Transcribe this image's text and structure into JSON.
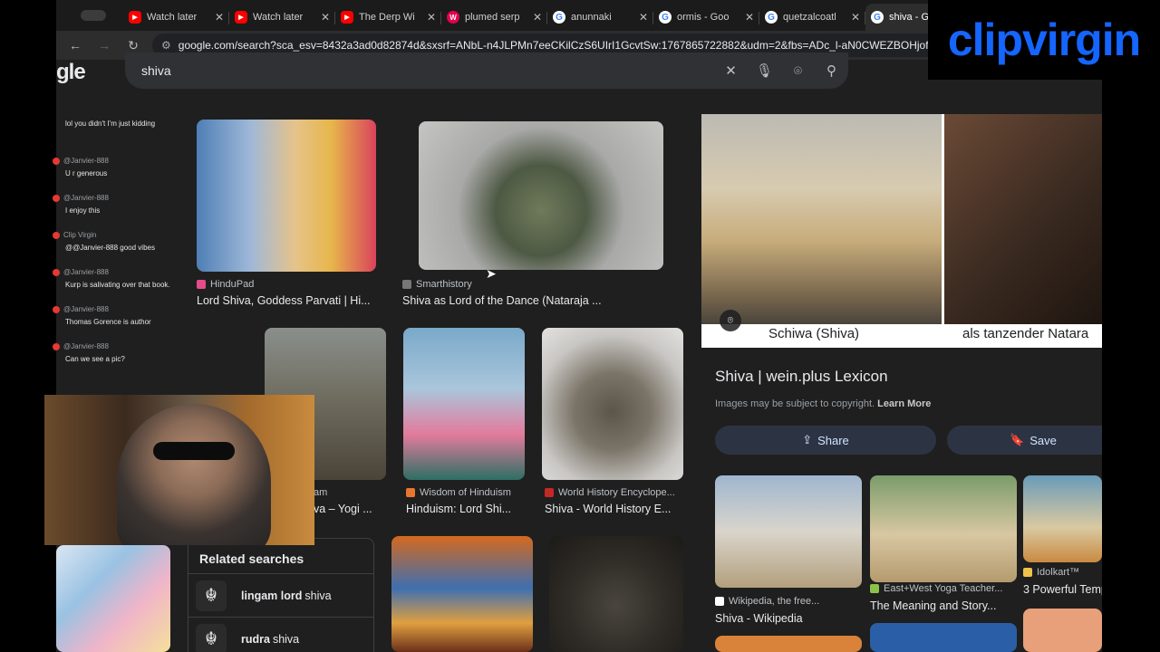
{
  "tabs": [
    {
      "title": "Watch later",
      "icon": "youtube-icon",
      "kind": "yt"
    },
    {
      "title": "Watch later",
      "icon": "youtube-icon",
      "kind": "yt"
    },
    {
      "title": "The Derp Wi",
      "icon": "youtube-icon",
      "kind": "yt"
    },
    {
      "title": "plumed serp",
      "icon": "wiki-icon",
      "kind": "wiki"
    },
    {
      "title": "anunnaki",
      "icon": "google-icon",
      "kind": "goog"
    },
    {
      "title": "ormis - Goo",
      "icon": "google-icon",
      "kind": "goog"
    },
    {
      "title": "quetzalcoatl",
      "icon": "google-icon",
      "kind": "goog"
    },
    {
      "title": "shiva - G",
      "icon": "google-icon",
      "kind": "goog",
      "active": true
    }
  ],
  "toolbar": {
    "url": "google.com/search?sca_esv=8432a3ad0d82874d&sxsrf=ANbL-n4JLPMn7eeCKilCzS6UIrI1GcvtSw:1767865722882&udm=2&fbs=ADc_l-aN0CWEZBOHjofHo"
  },
  "search": {
    "logo_fragment": "gle",
    "query": "shiva"
  },
  "results": [
    {
      "source": "HinduPad",
      "title": "Lord Shiva, Goddess Parvati | Hi...",
      "color": "#e54b8a"
    },
    {
      "source": "Smarthistory",
      "title": "Shiva as Lord of the Dance (Nataraja ...",
      "color": "#777777"
    },
    {
      "source": "Wisdom of Hinduism",
      "title": "Hinduism: Lord Shi...",
      "color": "#e8772e"
    },
    {
      "source": "World History Encyclope...",
      "title": "Shiva - World History E...",
      "color": "#c62828"
    },
    {
      "source": "am",
      "title": "va – Yogi ...",
      "color": "#8a6d3b"
    }
  ],
  "panel": {
    "captions": [
      "Schiwa (Shiva)",
      "als tanzender Natara"
    ],
    "title": "Shiva | wein.plus Lexicon",
    "copyright": "Images may be subject to copyright.",
    "learn_more": "Learn More",
    "share": "Share",
    "save": "Save",
    "related": [
      {
        "source": "Wikipedia, the free...",
        "title": "Shiva - Wikipedia"
      },
      {
        "source": "East+West Yoga Teacher...",
        "title": "The Meaning and Story..."
      },
      {
        "source": "Idolkart™",
        "title": "3 Powerful Temp"
      }
    ]
  },
  "related_searches": {
    "heading": "Related searches",
    "items": [
      {
        "bold": "lingam lord",
        "rest": "shiva"
      },
      {
        "bold": "rudra",
        "rest": "shiva"
      }
    ]
  },
  "chat": [
    {
      "name": "",
      "text": "lol you didn't I'm just kidding"
    },
    {
      "name": "@Janvier-888",
      "text": "U r generous"
    },
    {
      "name": "@Janvier-888",
      "text": "I enjoy this"
    },
    {
      "name": "Clip Virgin",
      "text": "@@Janvier-888 good vibes"
    },
    {
      "name": "@Janvier-888",
      "text": "Kurp is salivating over that book."
    },
    {
      "name": "@Janvier-888",
      "text": "Thomas Gorence is author"
    },
    {
      "name": "@Janvier-888",
      "text": "Can we see a pic?"
    }
  ],
  "brand": "clipvirgin"
}
